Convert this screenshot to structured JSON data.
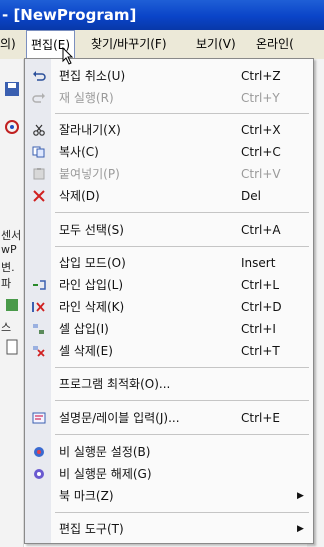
{
  "window": {
    "title": "- [NewProgram]"
  },
  "menubar": {
    "items": [
      {
        "label": "의)"
      },
      {
        "label": "편집(E)"
      },
      {
        "label": "찾기/바꾸기(F)"
      },
      {
        "label": "보기(V)"
      },
      {
        "label": "온라인("
      }
    ]
  },
  "left_strip": {
    "labels": [
      "센서",
      "wP",
      "변.",
      "파",
      "스"
    ]
  },
  "edit_menu": {
    "items": [
      {
        "label": "편집 취소(U)",
        "shortcut": "Ctrl+Z",
        "icon": "undo-icon",
        "disabled": false
      },
      {
        "label": "재 실행(R)",
        "shortcut": "Ctrl+Y",
        "icon": "redo-icon",
        "disabled": true
      },
      {
        "label": "잘라내기(X)",
        "shortcut": "Ctrl+X",
        "icon": "scissors-icon",
        "disabled": false
      },
      {
        "label": "복사(C)",
        "shortcut": "Ctrl+C",
        "icon": "copy-icon",
        "disabled": false
      },
      {
        "label": "붙여넣기(P)",
        "shortcut": "Ctrl+V",
        "icon": "paste-icon",
        "disabled": true
      },
      {
        "label": "삭제(D)",
        "shortcut": "Del",
        "icon": "delete-x-icon",
        "disabled": false
      },
      {
        "label": "모두 선택(S)",
        "shortcut": "Ctrl+A",
        "icon": "",
        "disabled": false
      },
      {
        "label": "삽입 모드(O)",
        "shortcut": "Insert",
        "icon": "",
        "disabled": false
      },
      {
        "label": "라인 삽입(L)",
        "shortcut": "Ctrl+L",
        "icon": "insert-line-icon",
        "disabled": false
      },
      {
        "label": "라인 삭제(K)",
        "shortcut": "Ctrl+D",
        "icon": "delete-line-icon",
        "disabled": false
      },
      {
        "label": "셀 삽입(I)",
        "shortcut": "Ctrl+I",
        "icon": "insert-cell-icon",
        "disabled": false
      },
      {
        "label": "셀 삭제(E)",
        "shortcut": "Ctrl+T",
        "icon": "delete-cell-icon",
        "disabled": false
      },
      {
        "label": "프로그램 최적화(O)...",
        "shortcut": "",
        "icon": "",
        "disabled": false
      },
      {
        "label": "설명문/레이블 입력(J)...",
        "shortcut": "Ctrl+E",
        "icon": "comment-label-icon",
        "disabled": false
      },
      {
        "label": "비 실행문 설정(B)",
        "shortcut": "",
        "icon": "set-nonexec-icon",
        "disabled": false
      },
      {
        "label": "비 실행문 해제(G)",
        "shortcut": "",
        "icon": "clear-nonexec-icon",
        "disabled": false
      },
      {
        "label": "북 마크(Z)",
        "shortcut": "",
        "icon": "submenu-arrow",
        "disabled": false
      },
      {
        "label": "편집 도구(T)",
        "shortcut": "",
        "icon": "submenu-arrow",
        "disabled": false
      }
    ]
  },
  "colors": {
    "titlebar": "#0a44c8",
    "menubar": "#ece9d8",
    "disabled_text": "#9a9a9a"
  }
}
